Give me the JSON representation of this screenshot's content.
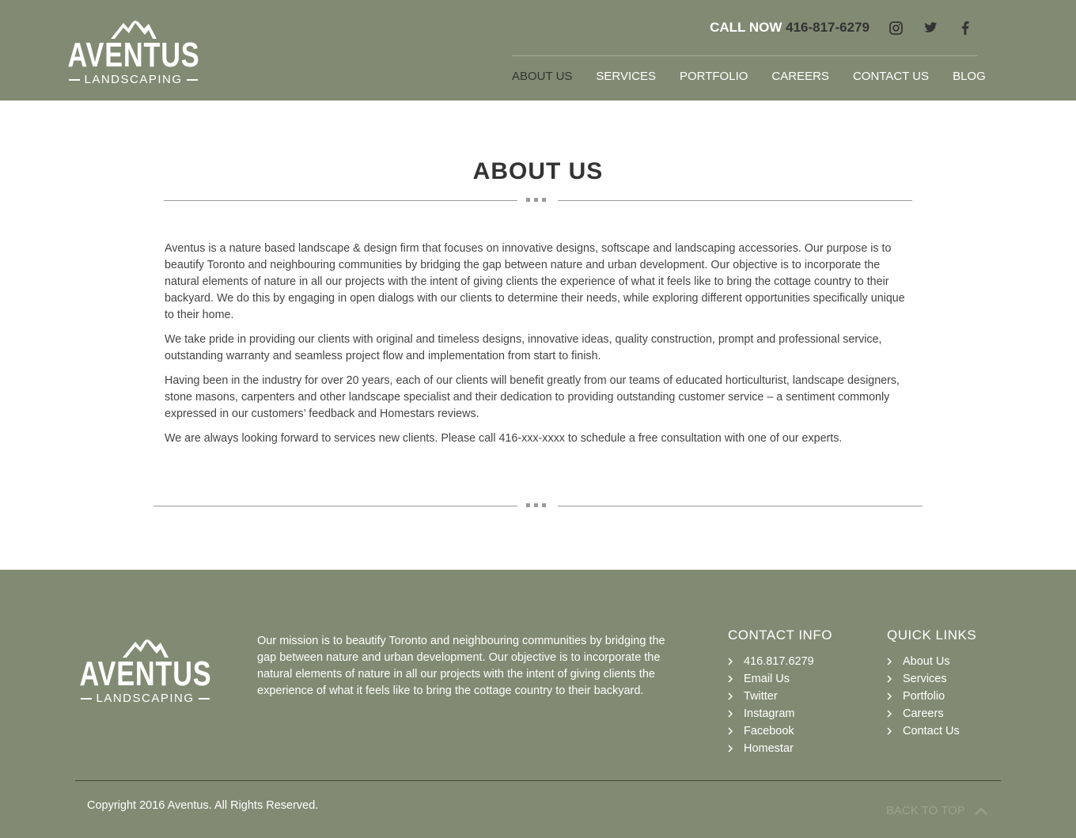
{
  "header": {
    "logo": {
      "word": "AVENTUS",
      "sub": "LANDSCAPING"
    },
    "call": {
      "label": "CALL NOW",
      "number": "416-817-6279"
    },
    "social_icons": [
      "instagram-icon",
      "twitter-icon",
      "facebook-icon"
    ],
    "nav": [
      {
        "label": "ABOUT US",
        "active": true
      },
      {
        "label": "SERVICES",
        "active": false
      },
      {
        "label": "PORTFOLIO",
        "active": false
      },
      {
        "label": "CAREERS",
        "active": false
      },
      {
        "label": "CONTACT US",
        "active": false
      },
      {
        "label": "BLOG",
        "active": false
      }
    ]
  },
  "main": {
    "title": "ABOUT US",
    "paragraphs": [
      "Aventus is a nature based landscape & design firm that focuses on innovative designs, softscape and landscaping accessories.  Our purpose is to beautify Toronto and neighbouring communities by bridging the gap between nature and urban development.  Our objective is to incorporate the natural elements of nature in all our projects with the intent of giving clients the experience of what it feels like to bring the cottage country to their backyard. We do this by engaging in open dialogs with our clients to determine their needs, while exploring different opportunities specifically unique to their home.",
      "We take pride in providing our clients with original and timeless designs, innovative ideas, quality construction, prompt and professional service, outstanding warranty and seamless project flow and implementation from start to finish.",
      "Having been in the industry for over 20 years, each of our clients will benefit greatly from our teams of educated horticulturist, landscape designers, stone masons, carpenters and other landscape specialist and their dedication to providing outstanding customer service – a sentiment commonly expressed in our customers’ feedback and Homestars reviews.",
      "We are always looking forward to services new clients.  Please call 416-xxx-xxxx to schedule a free consultation with one of our experts."
    ]
  },
  "footer": {
    "logo": {
      "word": "AVENTUS",
      "sub": "LANDSCAPING"
    },
    "mission": "Our mission is to beautify Toronto and neighbouring communities by bridging the gap between nature and urban development. Our objective is to incorporate the natural elements of nature in all our projects with the intent of giving clients the experience of what it feels like to bring the cottage country to their backyard.",
    "contact": {
      "title": "CONTACT INFO",
      "links": [
        "416.817.6279",
        "Email Us",
        "Twitter",
        "Instagram",
        "Facebook",
        "Homestar"
      ]
    },
    "quick": {
      "title": "QUICK LINKS",
      "links": [
        "About Us",
        "Services",
        "Portfolio",
        "Careers",
        "Contact Us"
      ]
    },
    "copyright": "Copyright 2016 Aventus. All Rights Reserved.",
    "back_to_top": "BACK TO TOP"
  },
  "colors": {
    "brand_green": "#818b73",
    "text_dark": "#333333",
    "divider_gray": "#9b9b9b"
  }
}
